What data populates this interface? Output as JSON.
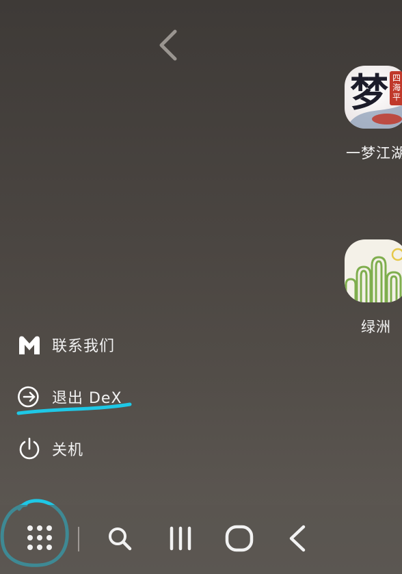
{
  "top_nav": {
    "icon": "chevron-left-icon"
  },
  "home_apps": [
    {
      "label": "一梦江湖",
      "icon": "yimeng-jianghu-app-icon",
      "icon_text": "梦",
      "badge_text": "四海平"
    },
    {
      "label": "绿洲",
      "icon": "lvzhou-app-icon"
    }
  ],
  "dex_menu": {
    "items": [
      {
        "label": "联系我们",
        "icon": "samsung-members-icon"
      },
      {
        "label": "退出 DeX",
        "icon": "exit-arrow-icon"
      },
      {
        "label": "关机",
        "icon": "power-icon"
      }
    ]
  },
  "taskbar": {
    "apps_button": "apps-grid-icon",
    "search_button": "search-icon",
    "recents_button": "recents-icon",
    "home_button": "home-icon",
    "back_button": "back-icon"
  },
  "annotation_color": "#1ec8e6"
}
